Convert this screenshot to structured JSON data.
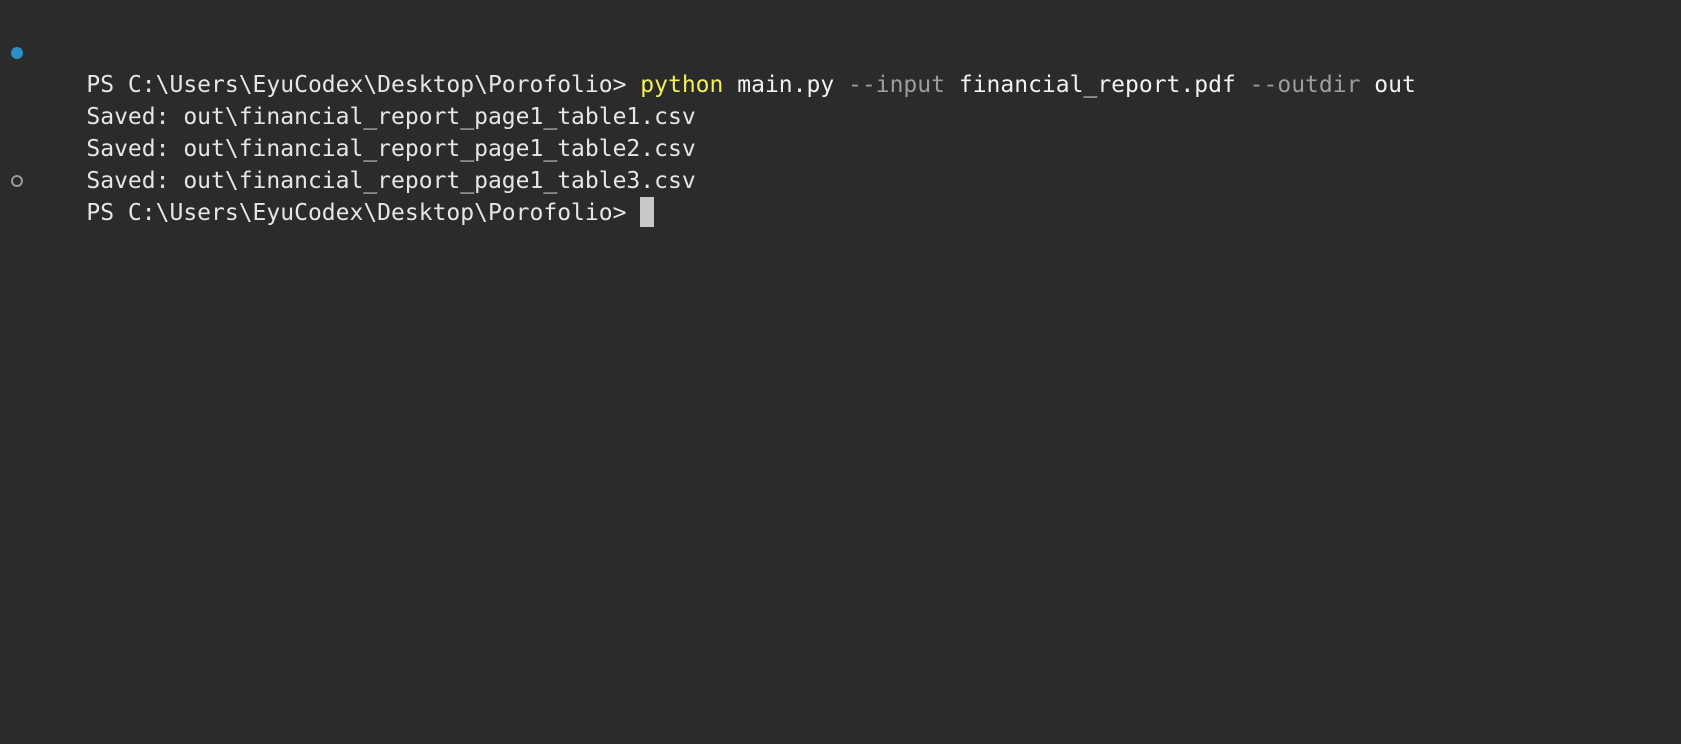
{
  "terminal": {
    "prompt": "PS C:\\Users\\EyuCodex\\Desktop\\Porofolio>",
    "command": {
      "program": "python",
      "script": "main.py",
      "flag_input": "--input",
      "input_value": "financial_report.pdf",
      "flag_outdir": "--outdir",
      "outdir_value": "out"
    },
    "output": [
      "Saved: out\\financial_report_page1_table1.csv",
      "Saved: out\\financial_report_page1_table2.csv",
      "Saved: out\\financial_report_page1_table3.csv"
    ],
    "colors": {
      "background": "#2b2b2b",
      "text": "#e6e6e6",
      "command": "#f4f24b",
      "flag": "#9d9d9d",
      "success_marker": "#2a8fc7"
    }
  }
}
